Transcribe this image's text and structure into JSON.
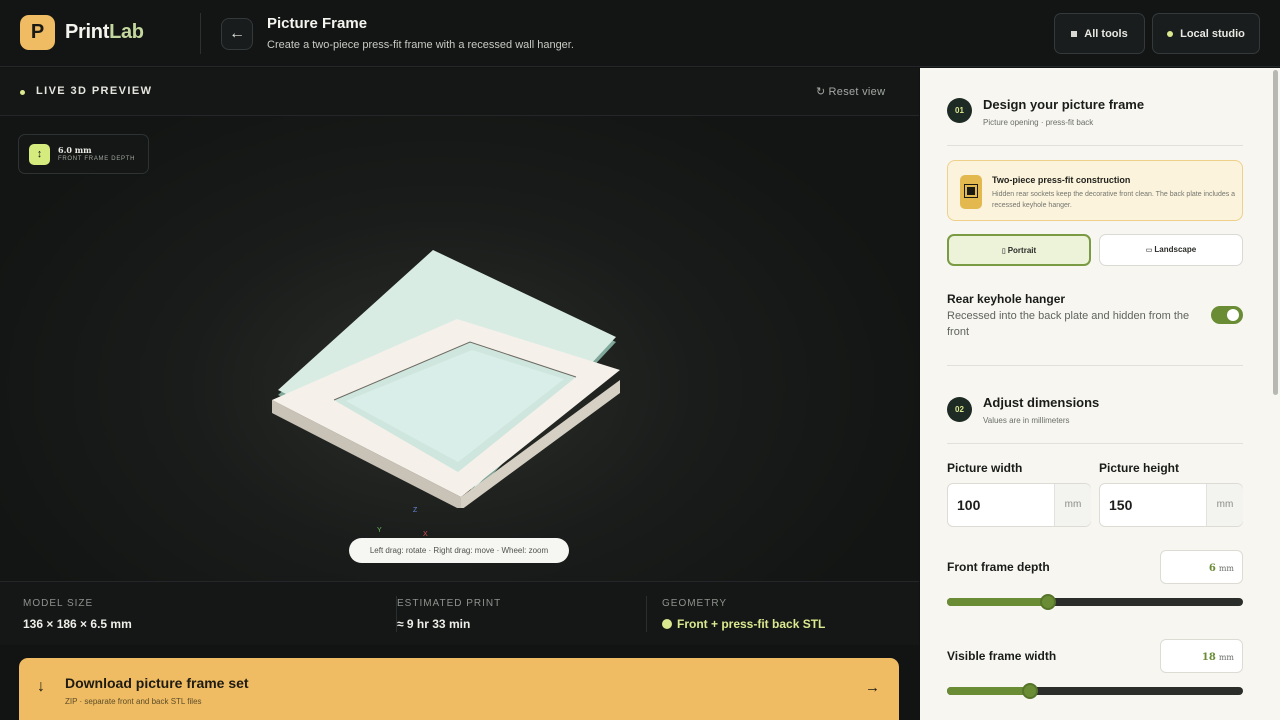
{
  "header": {
    "logo_letter": "P",
    "brand_main": "Print",
    "brand_accent": "Lab",
    "back_icon": "arrow-left-icon",
    "title": "Picture Frame",
    "subtitle": "Create a two-piece press-fit frame with a recessed wall hanger.",
    "all_tools_label": "All tools",
    "local_studio_label": "Local studio"
  },
  "preview": {
    "live_label": "LIVE 3D PREVIEW",
    "reset_label": "Reset view",
    "depth_badge": {
      "value": "6.0 mm",
      "caption": "FRONT FRAME DEPTH"
    },
    "axes": {
      "z": "Z",
      "y": "Y",
      "x": "X"
    },
    "hint": "Left drag: rotate · Right drag: move · Wheel: zoom"
  },
  "stats": {
    "model_size_label": "MODEL SIZE",
    "model_size_value": "136 × 186 × 6.5 mm",
    "estimated_print_label": "ESTIMATED PRINT",
    "estimated_print_value": "≈ 9 hr 33 min",
    "geometry_label": "GEOMETRY",
    "geometry_value": "Front + press-fit back STL"
  },
  "download": {
    "title": "Download picture frame set",
    "subtitle": "ZIP · separate front and back STL files"
  },
  "panel": {
    "step1": {
      "number": "01",
      "title": "Design your picture frame",
      "subtitle": "Picture opening · press-fit back"
    },
    "info": {
      "title": "Two-piece press-fit construction",
      "text": "Hidden rear sockets keep the decorative front clean. The back plate includes a recessed keyhole hanger."
    },
    "orientation": {
      "portrait": "Portrait",
      "landscape": "Landscape",
      "selected": "Portrait"
    },
    "hanger": {
      "title": "Rear keyhole hanger",
      "description": "Recessed into the back plate and hidden from the front",
      "enabled": true
    },
    "step2": {
      "number": "02",
      "title": "Adjust dimensions",
      "subtitle": "Values are in millimeters"
    },
    "picture_width": {
      "label": "Picture width",
      "value": "100",
      "unit": "mm"
    },
    "picture_height": {
      "label": "Picture height",
      "value": "150",
      "unit": "mm"
    },
    "front_frame_depth": {
      "label": "Front frame depth",
      "value": "6",
      "unit": "mm",
      "slider_fraction": 0.34
    },
    "visible_frame_width": {
      "label": "Visible frame width",
      "value": "18",
      "unit": "mm",
      "slider_fraction": 0.28
    }
  },
  "colors": {
    "accent_orange": "#efbc63",
    "accent_lime": "#dbe88f",
    "accent_green": "#6a8c35",
    "dark_bg": "#111412",
    "panel_bg": "#f7f6f1"
  }
}
